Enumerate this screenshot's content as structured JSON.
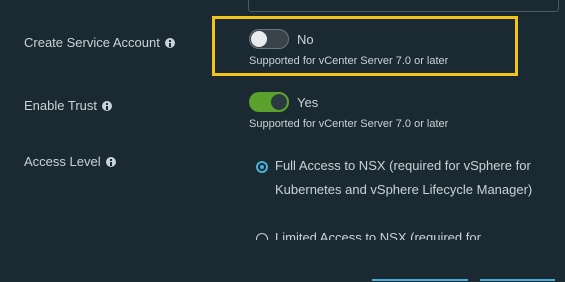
{
  "form": {
    "create_service_account": {
      "label": "Create Service Account",
      "toggle_state": "No",
      "hint": "Supported for vCenter Server 7.0 or later"
    },
    "enable_trust": {
      "label": "Enable Trust",
      "toggle_state": "Yes",
      "hint": "Supported for vCenter Server 7.0 or later"
    },
    "access_level": {
      "label": "Access Level",
      "options": [
        {
          "label": "Full Access to NSX (required for vSphere for Kubernetes and vSphere Lifecycle Manager)",
          "selected": true
        },
        {
          "label": "Limited Access to NSX (required for",
          "selected": false
        }
      ]
    }
  },
  "colors": {
    "background": "#1b2a32",
    "highlight": "#f2c318",
    "toggle_on": "#5aa22c",
    "radio_accent": "#49afd9"
  },
  "icons": {
    "info": "info-icon"
  }
}
